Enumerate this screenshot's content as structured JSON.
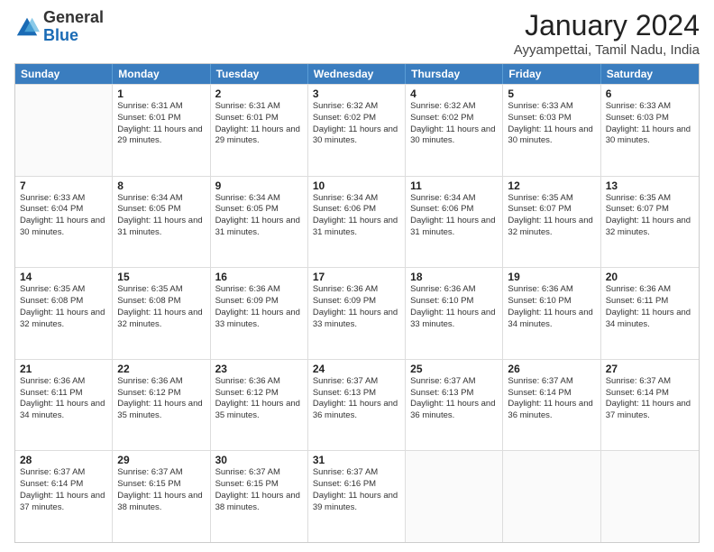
{
  "logo": {
    "general": "General",
    "blue": "Blue"
  },
  "title": "January 2024",
  "subtitle": "Ayyampettai, Tamil Nadu, India",
  "header_days": [
    "Sunday",
    "Monday",
    "Tuesday",
    "Wednesday",
    "Thursday",
    "Friday",
    "Saturday"
  ],
  "weeks": [
    [
      {
        "day": "",
        "sunrise": "",
        "sunset": "",
        "daylight": ""
      },
      {
        "day": "1",
        "sunrise": "Sunrise: 6:31 AM",
        "sunset": "Sunset: 6:01 PM",
        "daylight": "Daylight: 11 hours and 29 minutes."
      },
      {
        "day": "2",
        "sunrise": "Sunrise: 6:31 AM",
        "sunset": "Sunset: 6:01 PM",
        "daylight": "Daylight: 11 hours and 29 minutes."
      },
      {
        "day": "3",
        "sunrise": "Sunrise: 6:32 AM",
        "sunset": "Sunset: 6:02 PM",
        "daylight": "Daylight: 11 hours and 30 minutes."
      },
      {
        "day": "4",
        "sunrise": "Sunrise: 6:32 AM",
        "sunset": "Sunset: 6:02 PM",
        "daylight": "Daylight: 11 hours and 30 minutes."
      },
      {
        "day": "5",
        "sunrise": "Sunrise: 6:33 AM",
        "sunset": "Sunset: 6:03 PM",
        "daylight": "Daylight: 11 hours and 30 minutes."
      },
      {
        "day": "6",
        "sunrise": "Sunrise: 6:33 AM",
        "sunset": "Sunset: 6:03 PM",
        "daylight": "Daylight: 11 hours and 30 minutes."
      }
    ],
    [
      {
        "day": "7",
        "sunrise": "Sunrise: 6:33 AM",
        "sunset": "Sunset: 6:04 PM",
        "daylight": "Daylight: 11 hours and 30 minutes."
      },
      {
        "day": "8",
        "sunrise": "Sunrise: 6:34 AM",
        "sunset": "Sunset: 6:05 PM",
        "daylight": "Daylight: 11 hours and 31 minutes."
      },
      {
        "day": "9",
        "sunrise": "Sunrise: 6:34 AM",
        "sunset": "Sunset: 6:05 PM",
        "daylight": "Daylight: 11 hours and 31 minutes."
      },
      {
        "day": "10",
        "sunrise": "Sunrise: 6:34 AM",
        "sunset": "Sunset: 6:06 PM",
        "daylight": "Daylight: 11 hours and 31 minutes."
      },
      {
        "day": "11",
        "sunrise": "Sunrise: 6:34 AM",
        "sunset": "Sunset: 6:06 PM",
        "daylight": "Daylight: 11 hours and 31 minutes."
      },
      {
        "day": "12",
        "sunrise": "Sunrise: 6:35 AM",
        "sunset": "Sunset: 6:07 PM",
        "daylight": "Daylight: 11 hours and 32 minutes."
      },
      {
        "day": "13",
        "sunrise": "Sunrise: 6:35 AM",
        "sunset": "Sunset: 6:07 PM",
        "daylight": "Daylight: 11 hours and 32 minutes."
      }
    ],
    [
      {
        "day": "14",
        "sunrise": "Sunrise: 6:35 AM",
        "sunset": "Sunset: 6:08 PM",
        "daylight": "Daylight: 11 hours and 32 minutes."
      },
      {
        "day": "15",
        "sunrise": "Sunrise: 6:35 AM",
        "sunset": "Sunset: 6:08 PM",
        "daylight": "Daylight: 11 hours and 32 minutes."
      },
      {
        "day": "16",
        "sunrise": "Sunrise: 6:36 AM",
        "sunset": "Sunset: 6:09 PM",
        "daylight": "Daylight: 11 hours and 33 minutes."
      },
      {
        "day": "17",
        "sunrise": "Sunrise: 6:36 AM",
        "sunset": "Sunset: 6:09 PM",
        "daylight": "Daylight: 11 hours and 33 minutes."
      },
      {
        "day": "18",
        "sunrise": "Sunrise: 6:36 AM",
        "sunset": "Sunset: 6:10 PM",
        "daylight": "Daylight: 11 hours and 33 minutes."
      },
      {
        "day": "19",
        "sunrise": "Sunrise: 6:36 AM",
        "sunset": "Sunset: 6:10 PM",
        "daylight": "Daylight: 11 hours and 34 minutes."
      },
      {
        "day": "20",
        "sunrise": "Sunrise: 6:36 AM",
        "sunset": "Sunset: 6:11 PM",
        "daylight": "Daylight: 11 hours and 34 minutes."
      }
    ],
    [
      {
        "day": "21",
        "sunrise": "Sunrise: 6:36 AM",
        "sunset": "Sunset: 6:11 PM",
        "daylight": "Daylight: 11 hours and 34 minutes."
      },
      {
        "day": "22",
        "sunrise": "Sunrise: 6:36 AM",
        "sunset": "Sunset: 6:12 PM",
        "daylight": "Daylight: 11 hours and 35 minutes."
      },
      {
        "day": "23",
        "sunrise": "Sunrise: 6:36 AM",
        "sunset": "Sunset: 6:12 PM",
        "daylight": "Daylight: 11 hours and 35 minutes."
      },
      {
        "day": "24",
        "sunrise": "Sunrise: 6:37 AM",
        "sunset": "Sunset: 6:13 PM",
        "daylight": "Daylight: 11 hours and 36 minutes."
      },
      {
        "day": "25",
        "sunrise": "Sunrise: 6:37 AM",
        "sunset": "Sunset: 6:13 PM",
        "daylight": "Daylight: 11 hours and 36 minutes."
      },
      {
        "day": "26",
        "sunrise": "Sunrise: 6:37 AM",
        "sunset": "Sunset: 6:14 PM",
        "daylight": "Daylight: 11 hours and 36 minutes."
      },
      {
        "day": "27",
        "sunrise": "Sunrise: 6:37 AM",
        "sunset": "Sunset: 6:14 PM",
        "daylight": "Daylight: 11 hours and 37 minutes."
      }
    ],
    [
      {
        "day": "28",
        "sunrise": "Sunrise: 6:37 AM",
        "sunset": "Sunset: 6:14 PM",
        "daylight": "Daylight: 11 hours and 37 minutes."
      },
      {
        "day": "29",
        "sunrise": "Sunrise: 6:37 AM",
        "sunset": "Sunset: 6:15 PM",
        "daylight": "Daylight: 11 hours and 38 minutes."
      },
      {
        "day": "30",
        "sunrise": "Sunrise: 6:37 AM",
        "sunset": "Sunset: 6:15 PM",
        "daylight": "Daylight: 11 hours and 38 minutes."
      },
      {
        "day": "31",
        "sunrise": "Sunrise: 6:37 AM",
        "sunset": "Sunset: 6:16 PM",
        "daylight": "Daylight: 11 hours and 39 minutes."
      },
      {
        "day": "",
        "sunrise": "",
        "sunset": "",
        "daylight": ""
      },
      {
        "day": "",
        "sunrise": "",
        "sunset": "",
        "daylight": ""
      },
      {
        "day": "",
        "sunrise": "",
        "sunset": "",
        "daylight": ""
      }
    ]
  ]
}
